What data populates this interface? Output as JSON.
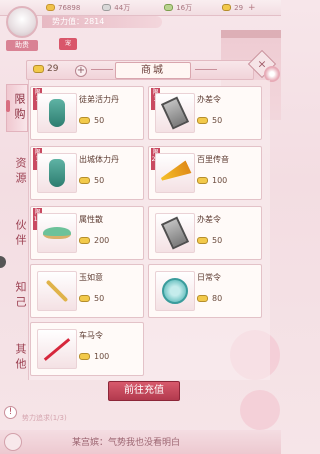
{
  "topbar": {
    "resources": [
      {
        "icon": "ingot-icon",
        "value": "76898"
      },
      {
        "icon": "silver-icon",
        "value": "44万"
      },
      {
        "icon": "book-icon",
        "value": "16万"
      },
      {
        "icon": "gold-ingot-icon",
        "value": "29"
      }
    ]
  },
  "player": {
    "power_label": "势力值：2814",
    "avatar_label": "助贵",
    "seal_label": "宠"
  },
  "shop": {
    "ingot_count": "29",
    "title": "商城"
  },
  "tabs": [
    "限购",
    "资源",
    "伙伴",
    "知己",
    "其他"
  ],
  "items": [
    {
      "name": "徒弟活力丹",
      "price": "50",
      "limit": "限\n3",
      "icon": "vase-icon"
    },
    {
      "name": "办差令",
      "price": "50",
      "limit": "限\n3",
      "icon": "token-icon"
    },
    {
      "name": "出城体力丹",
      "price": "50",
      "limit": "限\n3",
      "icon": "vase-icon"
    },
    {
      "name": "百里传音",
      "price": "100",
      "limit": "限\n20",
      "icon": "horn-icon"
    },
    {
      "name": "属性散",
      "price": "200",
      "limit": "限\n10",
      "icon": "powder-icon"
    },
    {
      "name": "办差令",
      "price": "50",
      "limit": "",
      "icon": "token-icon"
    },
    {
      "name": "玉如意",
      "price": "50",
      "limit": "",
      "icon": "pin-icon"
    },
    {
      "name": "日常令",
      "price": "80",
      "limit": "",
      "icon": "jade-icon"
    },
    {
      "name": "车马令",
      "price": "100",
      "limit": "",
      "icon": "whip-icon"
    }
  ],
  "recharge_label": "前往充值",
  "bottom_notice": "势力追求(1/3)",
  "chat_text": "某宫嫔：气势我也没看明白"
}
